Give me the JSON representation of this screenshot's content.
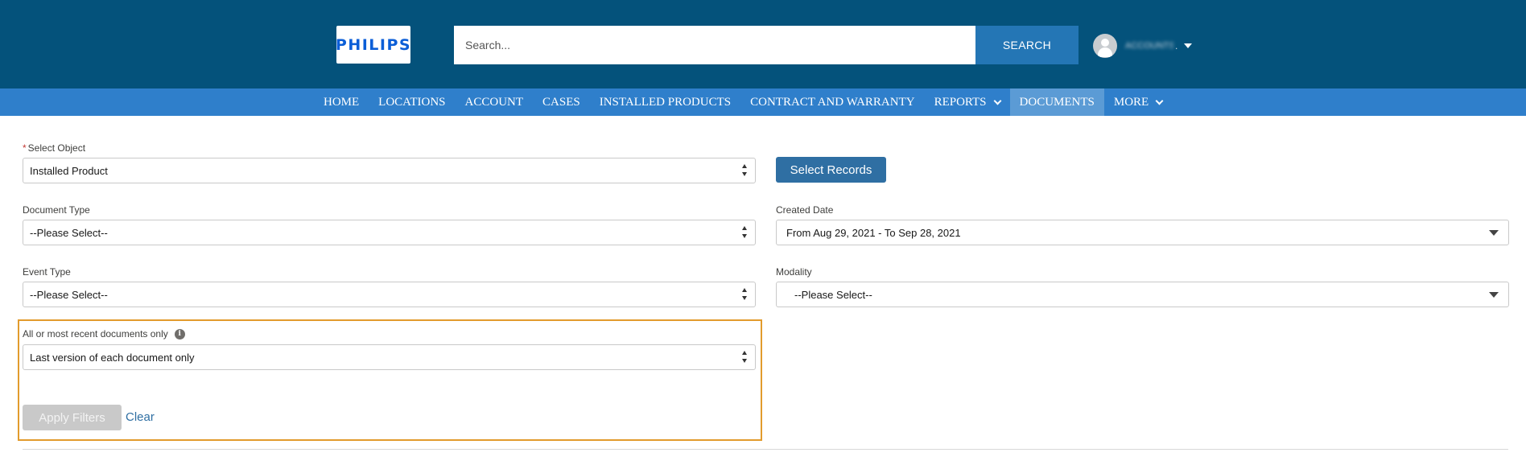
{
  "header": {
    "logo_text": "PHILIPS",
    "search_placeholder": "Search...",
    "search_button": "SEARCH",
    "user_name": "ACCOUNTS",
    "user_suffix": "."
  },
  "nav": {
    "items": [
      {
        "label": "HOME"
      },
      {
        "label": "LOCATIONS"
      },
      {
        "label": "ACCOUNT"
      },
      {
        "label": "CASES"
      },
      {
        "label": "INSTALLED PRODUCTS"
      },
      {
        "label": "CONTRACT AND WARRANTY"
      },
      {
        "label": "REPORTS"
      },
      {
        "label": "DOCUMENTS",
        "active": true
      },
      {
        "label": "MORE"
      }
    ]
  },
  "form": {
    "select_object": {
      "required_mark": "*",
      "label": "Select Object",
      "value": "Installed Product"
    },
    "select_records_button": "Select Records",
    "document_type": {
      "label": "Document Type",
      "value": "--Please Select--"
    },
    "created_date": {
      "label": "Created Date",
      "value": "From Aug 29, 2021 - To Sep 28, 2021"
    },
    "event_type": {
      "label": "Event Type",
      "value": "--Please Select--"
    },
    "modality": {
      "label": "Modality",
      "value": "--Please Select--"
    },
    "recent_documents": {
      "label": "All or most recent documents only",
      "info_glyph": "i",
      "value": "Last version of each document only"
    },
    "apply_button": "Apply Filters",
    "clear_link": "Clear"
  },
  "colors": {
    "header_bg": "#04527b",
    "nav_bg": "#2f7fcb",
    "nav_active": "#5b9bd5",
    "highlight_border": "#e29b2d",
    "primary_button": "#2f6fa3"
  }
}
